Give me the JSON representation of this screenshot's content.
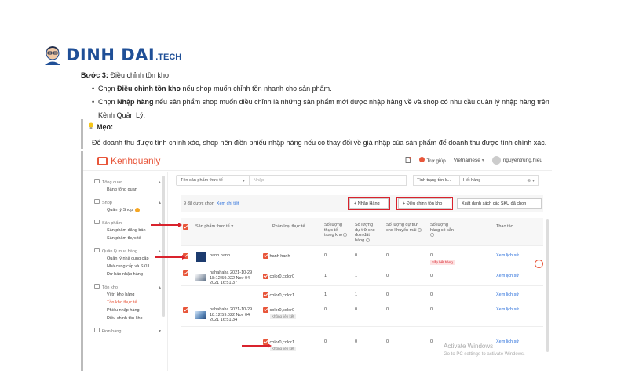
{
  "logo": {
    "text": "DINH DAI",
    "suffix": ".TECH"
  },
  "article": {
    "step_label": "Bước 3:",
    "step_text": " Điều chỉnh tồn kho",
    "bullet1_prefix": "Chọn ",
    "bullet1_bold": "Điều chỉnh tồn kho",
    "bullet1_rest": " nếu shop muốn chỉnh tồn nhanh cho sản phẩm.",
    "bullet2_prefix": "Chọn ",
    "bullet2_bold": "Nhập hàng",
    "bullet2_rest": " nếu sản phẩm shop muốn điều chỉnh là những sản phẩm mới được nhập hàng về và shop có nhu cầu quản lý nhập hàng trên",
    "bullet2_cont": "Kênh Quản Lý.",
    "tip_title": "Mẹo:",
    "tip_text": "Để doanh thu được tính chính xác, shop nên điền phiếu nhập hàng nếu có thay đổi về giá nhập của sản phẩm để doanh thu được tính chính xác."
  },
  "app": {
    "brand": "Kenhquanly",
    "help": "Trợ giúp",
    "language": "Vietnamese",
    "user": "nguyentrung.hieu"
  },
  "sidebar": {
    "groups": [
      {
        "title": "Tổng quan",
        "items": [
          "Bảng tổng quan"
        ]
      },
      {
        "title": "Shop",
        "items": [
          "Quản lý Shop"
        ]
      },
      {
        "title": "Sản phẩm",
        "items": [
          "Sản phẩm đăng bán",
          "Sản phẩm thực tế"
        ]
      },
      {
        "title": "Quản lý mua hàng",
        "items": [
          "Quản lý nhà cung cấp",
          "Nhà cung cấp và SKU",
          "Dự báo nhập hàng"
        ]
      },
      {
        "title": "Tồn kho",
        "items": [
          "Vị trí kho hàng",
          "Tồn kho thực tế",
          "Phiếu nhập hàng",
          "Điều chỉnh tồn kho"
        ]
      },
      {
        "title": "Đơn hàng",
        "items": []
      }
    ]
  },
  "filters": {
    "product_select": "Tên sản phẩm thực tế",
    "search_placeholder": "Nhập",
    "stock_status": "Tình trạng tồn k...",
    "stock_value": "Hết hàng"
  },
  "actions": {
    "selected_count": "9 đã được chọn",
    "detail_link": "Xem chi tiết",
    "import_button": "+ Nhập Hàng",
    "adjust_button": "+ Điều chỉnh tồn kho",
    "export_button": "Xuất danh sách các SKU đã chọn"
  },
  "table": {
    "headers": {
      "product": "Sản phẩm thực tế",
      "variant": "Phân loại thực tế",
      "in_stock": "Số lượng thực tế trong kho",
      "reserved_order": "Số lượng dự trữ cho đơn đặt hàng",
      "reserved_promo": "Số lượng dự trữ cho khuyến mãi",
      "available": "Số lượng hàng có sẵn",
      "actions": "Thao tác"
    },
    "rows": [
      {
        "product": "hanh hanh",
        "variant": "hanh hanh",
        "variant_tag": "",
        "in_stock": "0",
        "reserved_order": "0",
        "reserved_promo": "0",
        "available": "0",
        "available_tag": "Sắp hết hàng",
        "action": "Xem lịch sử"
      },
      {
        "product": "hahahaha 2021-10-29 18:12:59.022 Nov 04 2021 16:51:37",
        "variant": "color0,color0",
        "variant_tag": "",
        "in_stock": "1",
        "reserved_order": "1",
        "reserved_promo": "0",
        "available": "0",
        "available_tag": "",
        "action": "Xem lịch sử"
      },
      {
        "product": "",
        "variant": "color0,color1",
        "variant_tag": "",
        "in_stock": "1",
        "reserved_order": "1",
        "reserved_promo": "0",
        "available": "0",
        "available_tag": "",
        "action": "Xem lịch sử"
      },
      {
        "product": "hahahaha 2021-10-29 18:12:59.022 Nov 04 2021 16:51:34",
        "variant": "color0,color0",
        "variant_tag": "Không liên kết",
        "in_stock": "0",
        "reserved_order": "0",
        "reserved_promo": "0",
        "available": "0",
        "available_tag": "",
        "action": "Xem lịch sử"
      },
      {
        "product": "",
        "variant": "color0,color1",
        "variant_tag": "Không liên kết",
        "in_stock": "0",
        "reserved_order": "0",
        "reserved_promo": "0",
        "available": "0",
        "available_tag": "",
        "action": "Xem lịch sử"
      }
    ]
  },
  "watermark": {
    "title": "Activate Windows",
    "sub": "Go to PC settings to activate Windows."
  },
  "colors": {
    "accent": "#e8563a",
    "highlight_red": "#d9232d",
    "link": "#2a6fdb",
    "logo_blue": "#1f4f97"
  }
}
